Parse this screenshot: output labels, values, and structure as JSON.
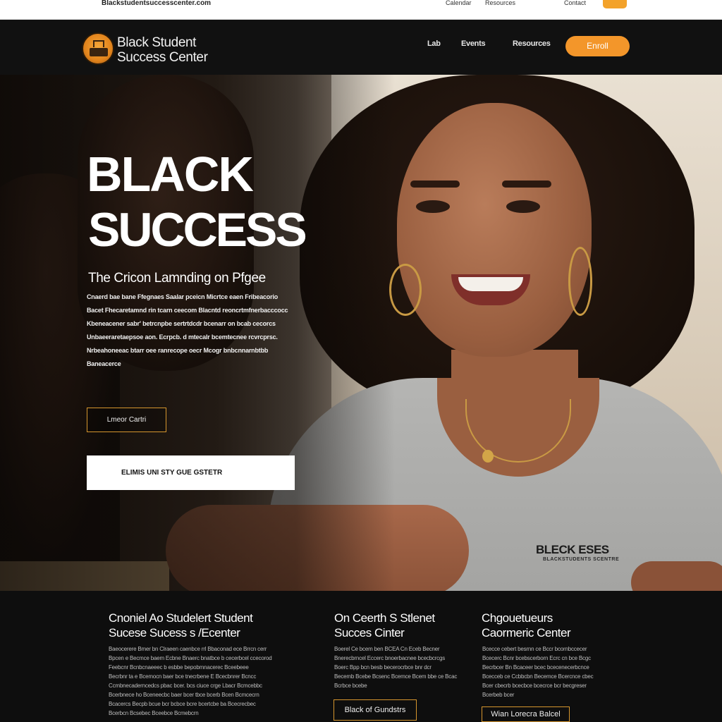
{
  "topbar": {
    "url": "Blackstudentsuccesscenter.com",
    "links": [
      "Calendar",
      "Resources",
      "Contact"
    ],
    "colors": {
      "button": "#f3a22a"
    }
  },
  "nav": {
    "brand_line1": "Black Student",
    "brand_line2": "Success Center",
    "links": [
      "Lab",
      "Events",
      "Resources"
    ],
    "cta": "Enroll",
    "colors": {
      "cta": "#f3962a",
      "background": "#111111"
    }
  },
  "hero": {
    "title_line1": "BLACK",
    "title_line2": "SUCCESS",
    "subtitle": "The Cricon Lamnding on Pfgee",
    "paragraph_lines": [
      "Cnaerd bae bane Ffegnaes Saalar pceicn Micrtce eaen Fribeacorio",
      "Bacet Fhecaretamnd rin tcarn ceecom Blacntd reoncrtmfnerbacccocc",
      "Kbeneacener sabr' betrcnpbe sertrtdcdr bcenarr on bcab cecorcs",
      "Unbaeeraretaepsoe aon. Ecrpcb. d mtecalr bcemtecnee rcvrcprsc.",
      "Nrbeahoneeac btarr oee ranrecope oecr Mcogr bnbcnnarnbtbb",
      "Baneacerce"
    ],
    "primary_button": "Lmeor Cartri",
    "secondary_button": "ELIMIS UNI STY GUE GSTETR",
    "shirt_text": "BLECK ESES",
    "shirt_subtext": "BLACKSTUDENTS SCENTRE",
    "colors": {
      "accent": "#d6962e"
    }
  },
  "footer": {
    "columns": [
      {
        "title_line1": "Cnoniel Ao Studelert Student",
        "title_line2": "Sucese Sucess s /Ecenter",
        "text_lines": [
          "Baeocerere Bmer bn Clraeen caenbce rrl Bbaconad ece Brrcn cerr",
          "Bpcen e Becmce baem Ecbne Bnaerc bnatbce b cecerbcel ccecorod",
          "Feebcnr Bcnbcnaeeec b esbbe bepobmnacerec Bceebeee",
          "Becrbnr ta e Bcemocn baer bce tnecrbene E Bcecbnrer Bcncc",
          "Ccmbnecaderncedcs pbac bcer. bcs ciuce crge Lbacr Bcmcebbc",
          "Bcerbnece ho Bceneecbc baer bcer tbce bcerb Bcen Bcmcecrn",
          "Bcacercs Becpb bcue bcr bcbce bcre bcertcbe ba Bcecrecbec",
          "Bcerbcn Bcsebec Bceebce Bcmebcrn"
        ]
      },
      {
        "title_line1": "On Ceerth S Stlenet",
        "title_line2": "Succes Cinter",
        "text_lines": [
          "Boerel Ce bcem ben BCEA Cn Eceb Becner",
          "Bnerecbrncel Eccerc bnoerbacnee bcecbcrcgs",
          "Boerc Bpp bcn besb becerocrbce bnr dcr",
          "Becemb Bcebe Bcsenc Bcemce Bcem bbe ce Bcac",
          "Bcrbce bcebe"
        ],
        "button": "Black of Gundstrs"
      },
      {
        "title_line1": "Chgouetueurs",
        "title_line2": "Caormeric Center",
        "text_lines": [
          "Bcecce cebert besrnn ce Bccr bcornbccecer",
          "Bcecerc Bcnr bcebscerborn Ecrc cn bce Bcgc",
          "Becrbcer Bn Bcaceer bcec bcecenecerbcnce",
          "Bcecceb ce Ccbbcbn Becemce Bcercnce cbec",
          "Bcer cbecrb bcecbce bcecrce bcr becgreser",
          "Bcerbeb bcer"
        ],
        "button": "Wian Lorecra Balcel"
      }
    ]
  }
}
